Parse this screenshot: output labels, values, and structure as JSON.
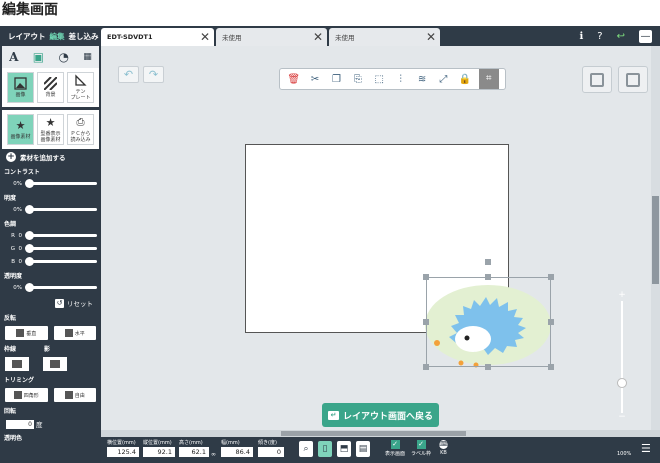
{
  "page_heading": "編集画面",
  "sidebar": {
    "tabs": [
      "レイアウト",
      "編集",
      "差し込み"
    ],
    "tools": [
      "A",
      "image",
      "shape",
      "barcode"
    ],
    "big_buttons": [
      {
        "label": "画像",
        "icon": "image-icon"
      },
      {
        "label": "背景",
        "icon": "background-icon"
      },
      {
        "label": "テン\nプレート",
        "icon": "template-icon"
      }
    ],
    "material_buttons": [
      {
        "label": "画像素材",
        "icon": "star-icon"
      },
      {
        "label": "型番表示\n画像素材",
        "icon": "star-icon"
      },
      {
        "label": "ＰＣから\n読み込み",
        "icon": "pc-icon"
      }
    ],
    "add_material": "素材を追加する",
    "contrast": {
      "label": "コントラスト",
      "value": "0%"
    },
    "brightness": {
      "label": "明度",
      "value": "0%"
    },
    "color": {
      "label": "色調",
      "r": "0",
      "g": "0",
      "b": "0",
      "r_label": "R",
      "g_label": "G",
      "b_label": "B"
    },
    "transparency": {
      "label": "透明度",
      "value": "0%"
    },
    "reset": "リセット",
    "flip": {
      "label": "反転",
      "vertical": "垂直",
      "horizontal": "水平"
    },
    "frame": "枠線",
    "shadow": "影",
    "trimming": {
      "label": "トリミング",
      "rect": "四角形",
      "free": "自由"
    },
    "rotation": {
      "label": "回転",
      "value": "0",
      "unit": "度"
    },
    "transparent_color": "透明色"
  },
  "tabs": [
    {
      "label": "EDT-SDVDT1",
      "active": true
    },
    {
      "label": "未使用",
      "active": false
    },
    {
      "label": "未使用",
      "active": false
    }
  ],
  "top_icons": [
    "ℹ",
    "?",
    "↩",
    "—"
  ],
  "back_button": "レイアウト画面へ戻る",
  "bottom_fields": [
    {
      "label": "横位置(mm)",
      "value": "125.4"
    },
    {
      "label": "縦位置(mm)",
      "value": "92.1"
    },
    {
      "label": "高さ(mm)",
      "value": "62.1"
    },
    {
      "label": "幅(mm)",
      "value": "86.4"
    },
    {
      "label": "傾き(度)",
      "value": "0"
    }
  ],
  "bottom_checks": [
    {
      "label": "表示画面"
    },
    {
      "label": "ラベル枠"
    },
    {
      "label": "KB"
    }
  ],
  "zoom": "100%"
}
